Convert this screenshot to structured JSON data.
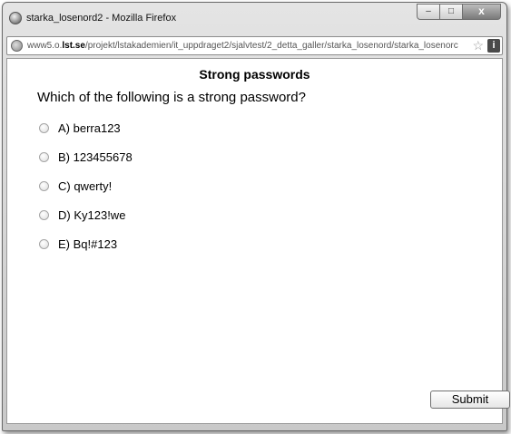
{
  "window": {
    "title": "starka_losenord2 - Mozilla Firefox",
    "controls": {
      "minimize": "–",
      "maximize": "□",
      "close": "x"
    }
  },
  "urlbar": {
    "url_prefix": "www5.o.",
    "url_domain": "lst.se",
    "url_path": "/projekt/lstakademien/it_uppdraget2/sjalvtest/2_detta_galler/starka_losenord/starka_losenorc",
    "star_icon": "star-icon",
    "info_icon": "i"
  },
  "page": {
    "heading": "Strong passwords",
    "question": "Which of the following is a strong password?",
    "options": [
      {
        "label": "A) berra123",
        "selected": false
      },
      {
        "label": "B) 123455678",
        "selected": false
      },
      {
        "label": "C) qwerty!",
        "selected": false
      },
      {
        "label": "D) Ky123!we",
        "selected": false
      },
      {
        "label": "E) Bq!#123",
        "selected": false
      }
    ],
    "submit_label": "Submit"
  }
}
